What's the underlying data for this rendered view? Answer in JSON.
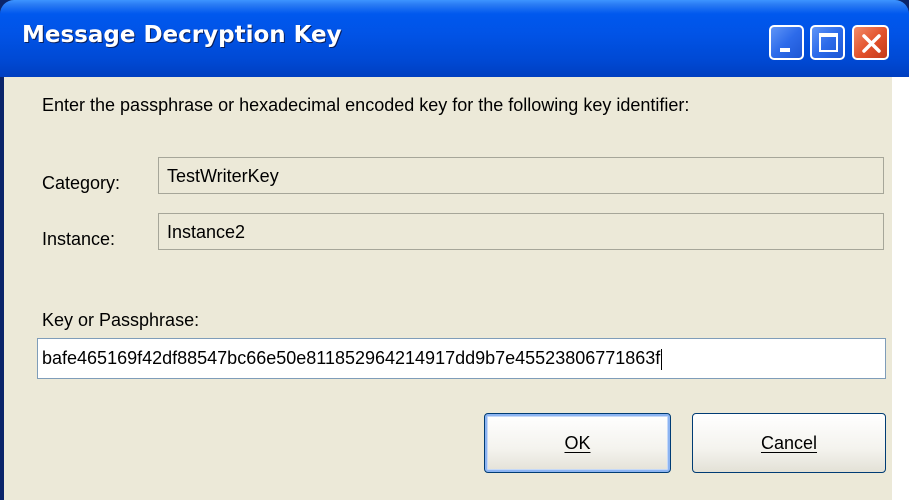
{
  "window": {
    "title": "Message Decryption Key",
    "controls": {
      "minimize_icon": "minimize-icon",
      "maximize_icon": "maximize-icon",
      "close_icon": "close-icon"
    }
  },
  "instruction": "Enter the passphrase or hexadecimal encoded key for the following key identifier:",
  "fields": {
    "category_label": "Category:",
    "category_value": "TestWriterKey",
    "instance_label": "Instance:",
    "instance_value": "Instance2",
    "key_label": "Key or Passphrase:",
    "key_value": "bafe465169f42df88547bc66e50e811852964214917dd9b7e45523806771863f"
  },
  "buttons": {
    "ok_label": "OK",
    "cancel_label": "Cancel"
  },
  "colors": {
    "titlebar": "#0054e3",
    "client": "#ece9d8",
    "close_button": "#e2502a"
  }
}
